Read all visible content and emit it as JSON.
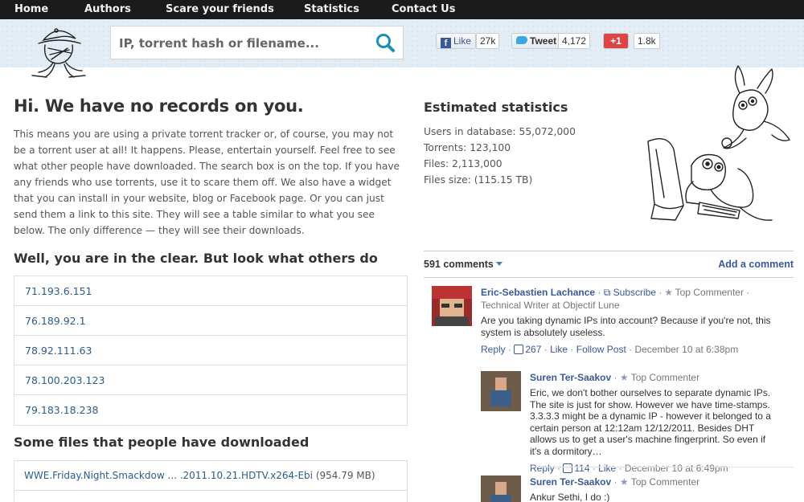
{
  "nav": {
    "items": [
      "Home",
      "Authors",
      "Scare your friends",
      "Statistics",
      "Contact Us"
    ]
  },
  "search": {
    "placeholder": "IP, torrent hash or filename..."
  },
  "social": {
    "facebook_label": "Like",
    "facebook_count": "27k",
    "twitter_label": "Tweet",
    "twitter_count": "4,172",
    "gplus_label": "+1",
    "gplus_count": "1.8k"
  },
  "main": {
    "heading": "Hi. We have no records on you.",
    "intro": "This means you are using a private torrent tracker or, of course, you may not be a torrent user at all! It happens. Please, entertain yourself. Feel free to see what other people have downloaded. The search box is on the top. If you have any friends who use torrents, use it to scare them off. We also have a widget that you can install in your website, blog or Facebook page. Or you can just send them a link to this site. They will see a table similar to what you see below. The only difference — they will see their downloads.",
    "clear_heading": "Well, you are in the clear. But look what others do",
    "ips": [
      "71.193.6.151",
      "76.189.92.1",
      "78.92.111.63",
      "78.100.203.123",
      "79.183.18.238"
    ],
    "files_heading": "Some files that people have downloaded",
    "files": [
      {
        "name": "WWE.Friday.Night.Smackdow ... .2011.10.21.HDTV.x264-Ebi",
        "size": "(954.79 MB)"
      }
    ]
  },
  "stats": {
    "title": "Estimated statistics",
    "users": "Users in database: 55,072,000",
    "torrents": "Torrents: 123,100",
    "files": "Files: 2,113,000",
    "size": "Files size: (115.15 TB)"
  },
  "comments": {
    "count": "591 comments",
    "add": "Add a comment",
    "items": [
      {
        "name": "Eric-Sebastien Lachance",
        "subscribe": "Subscribe",
        "meta": "Top Commenter · Technical Writer at Objectif Lune",
        "text": "Are you taking dynamic IPs into account? Because if you're not, this system is absolutely useless.",
        "reply": "Reply",
        "likes": "267",
        "like": "Like",
        "follow": "Follow Post",
        "time": "December 10 at 6:38pm"
      },
      {
        "name": "Suren Ter-Saakov",
        "meta": "Top Commenter",
        "text": "Eric, we don't bother ourselves to separate dynamic IPs. The site is just for show. However we have time-stamps. 3.3.3.3 might be a dynamic IP - however it belonged to a certain person at 12:12am 12/12/2011. Besides DHT allows us to get a user's machine fingerprint. So even if it's a dormitory…",
        "reply": "Reply",
        "likes": "114",
        "like": "Like",
        "time": "December 10 at 6:49pm"
      },
      {
        "name": "Suren Ter-Saakov",
        "meta": "Top Commenter",
        "text": "Ankur Sethi, I do :)"
      }
    ]
  }
}
